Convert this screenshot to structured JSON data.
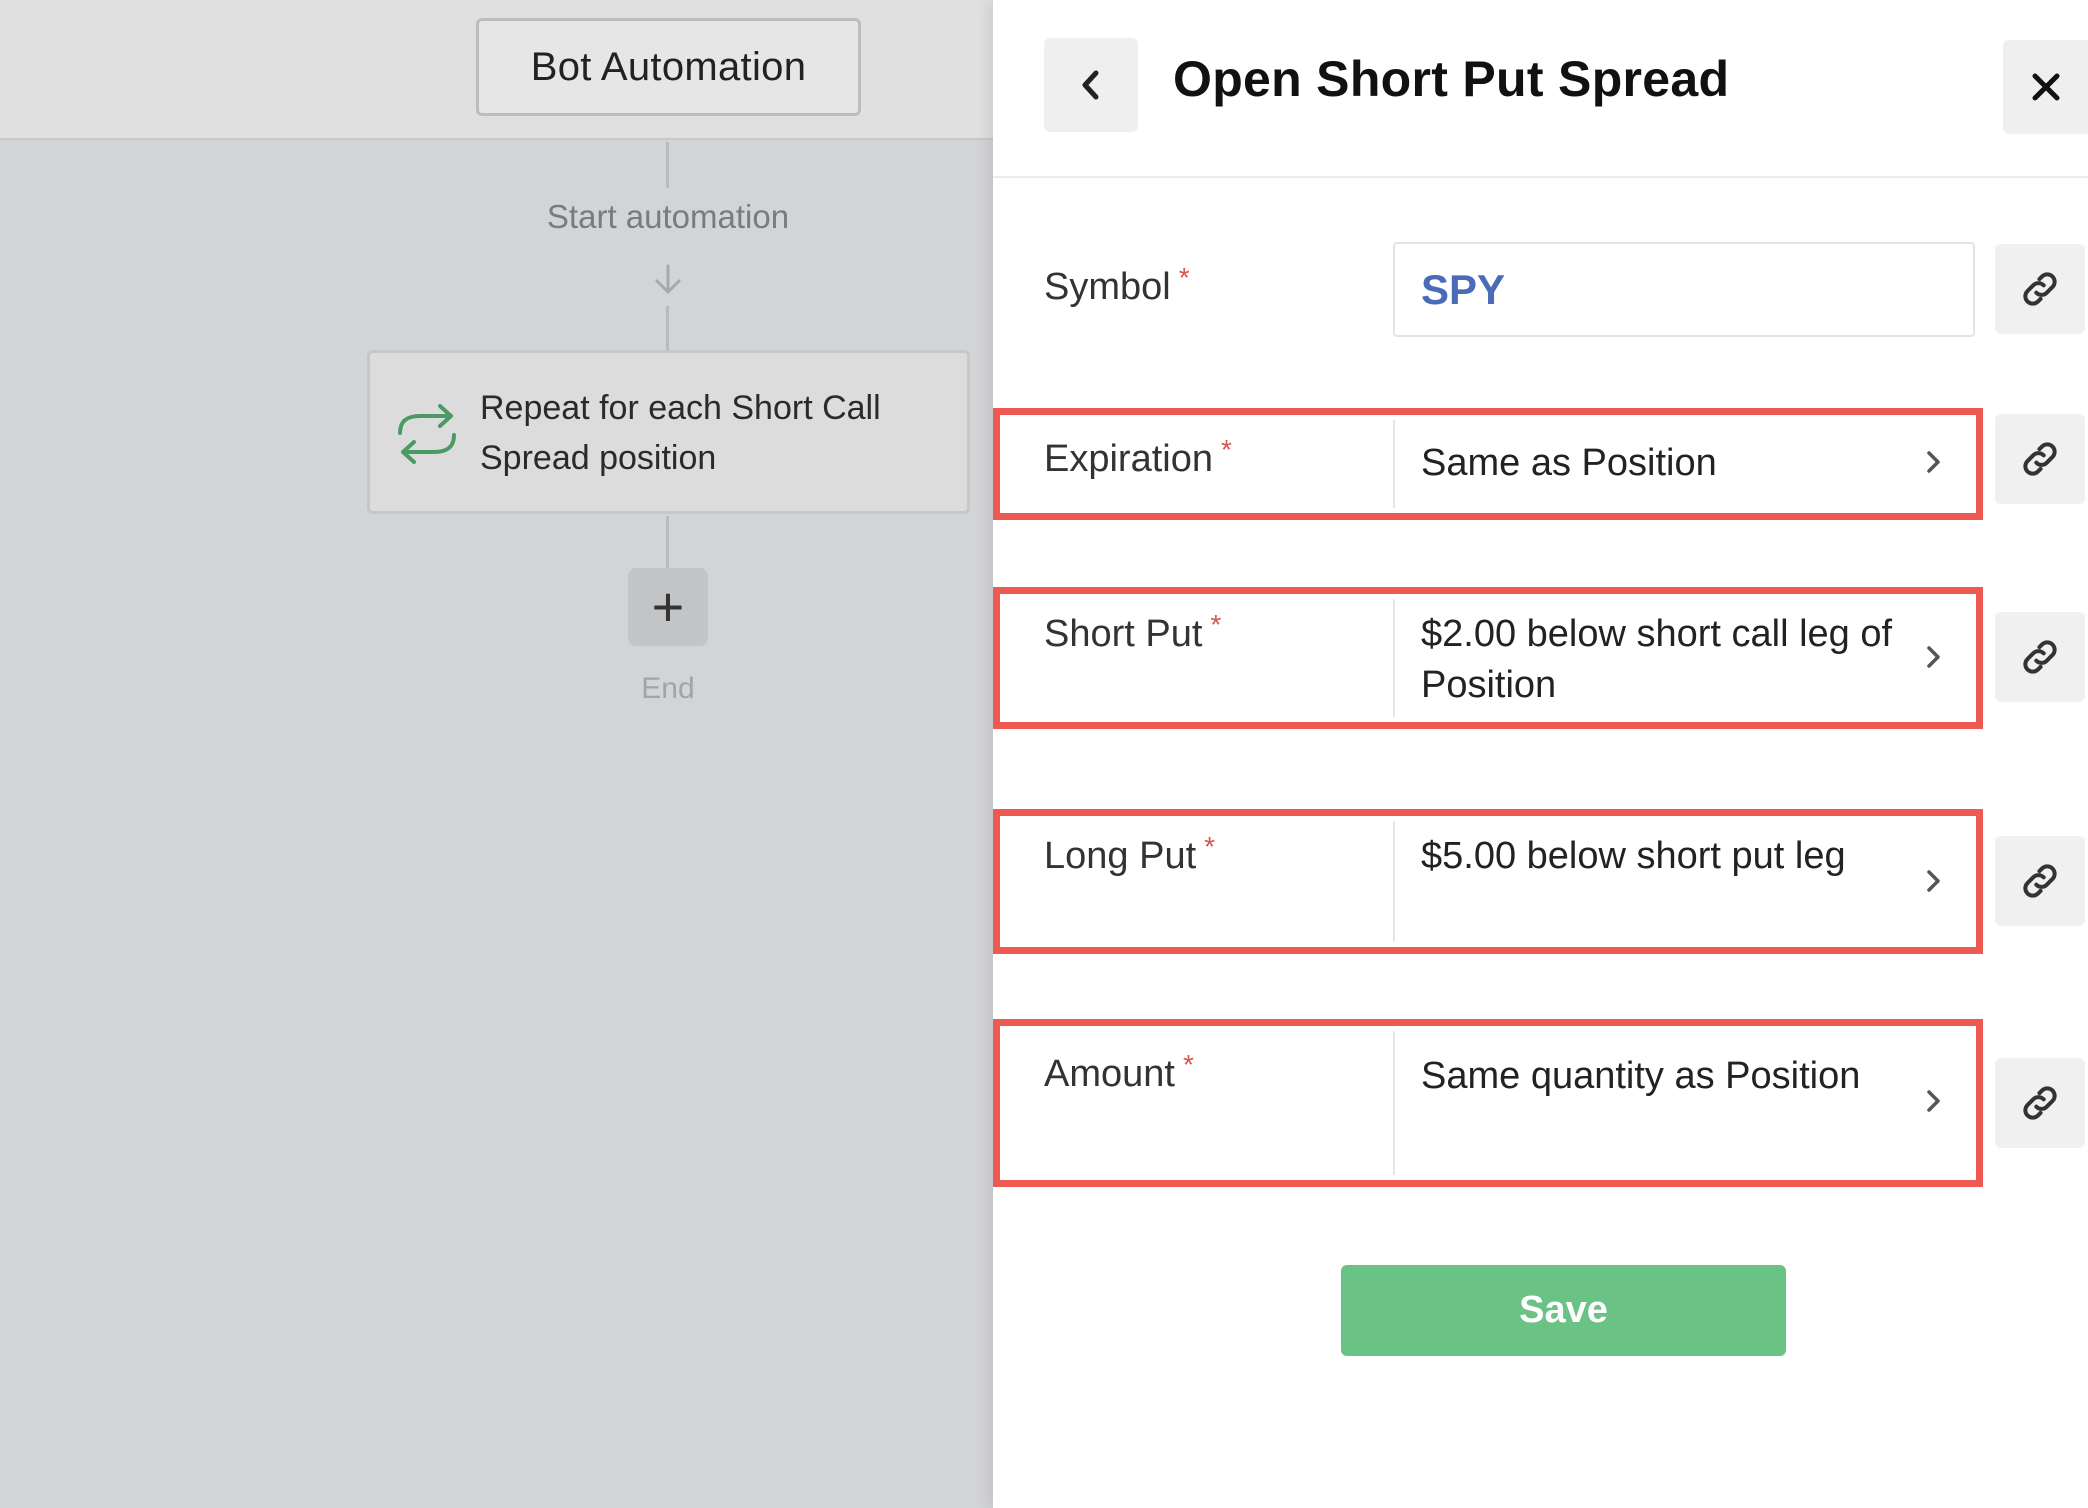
{
  "canvas": {
    "bot_title": "Bot Automation",
    "start_label": "Start automation",
    "repeat_step": "Repeat for each Short Call Spread position",
    "add_symbol": "+",
    "end_label": "End"
  },
  "panel": {
    "title": "Open Short Put Spread",
    "fields": {
      "symbol": {
        "label": "Symbol",
        "value": "SPY"
      },
      "expiration": {
        "label": "Expiration",
        "value": "Same as Position"
      },
      "short_put": {
        "label": "Short Put",
        "value": "$2.00 below short call leg of Position"
      },
      "long_put": {
        "label": "Long Put",
        "value": "$5.00 below short put leg"
      },
      "amount": {
        "label": "Amount",
        "value": "Same quantity as Position"
      }
    },
    "required_mark": "*",
    "save_label": "Save"
  },
  "colors": {
    "highlight": "#ee5a52",
    "save": "#6bc285",
    "symbol_text": "#4a6cb8",
    "required": "#d9534f",
    "repeat_icon": "#4a9a63"
  },
  "icons": [
    "arrow-down-icon",
    "repeat-icon",
    "plus-icon",
    "chevron-left-icon",
    "close-icon",
    "link-icon",
    "chevron-right-icon"
  ]
}
